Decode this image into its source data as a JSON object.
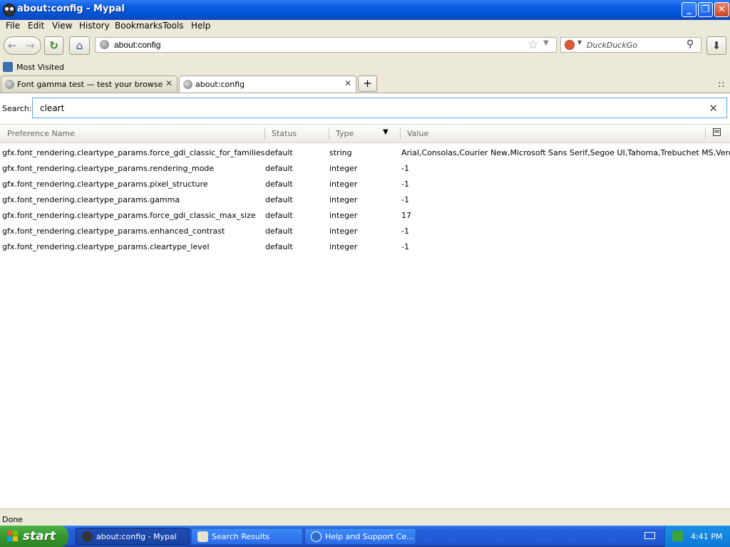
{
  "window": {
    "title": "about:config - Mypal",
    "minimize_label": "_",
    "maximize_label": "❐",
    "close_label": "✕"
  },
  "menu": [
    "File",
    "Edit",
    "View",
    "History",
    "Bookmarks",
    "Tools",
    "Help"
  ],
  "navbar": {
    "back_icon": "back-arrow-icon",
    "forward_icon": "forward-arrow-icon",
    "reload_icon": "reload-icon",
    "home_icon": "home-icon",
    "url": "about:config",
    "search_engine": "DuckDuckGo",
    "search_placeholder": "DuckDuckGo",
    "download_icon": "download-arrow-icon"
  },
  "bookmarks": {
    "most_visited": "Most Visited"
  },
  "tabs": [
    {
      "label": "Font gamma test — test your browser re...",
      "active": false
    },
    {
      "label": "about:config",
      "active": true
    }
  ],
  "config": {
    "search_label": "Search:",
    "search_value": "cleart",
    "columns": {
      "name": "Preference Name",
      "status": "Status",
      "type": "Type",
      "value": "Value"
    },
    "rows": [
      {
        "name": "gfx.font_rendering.cleartype_params.force_gdi_classic_for_families",
        "status": "default",
        "type": "string",
        "value": "Arial,Consolas,Courier New,Microsoft Sans Serif,Segoe UI,Tahoma,Trebuchet MS,Verdana"
      },
      {
        "name": "gfx.font_rendering.cleartype_params.rendering_mode",
        "status": "default",
        "type": "integer",
        "value": "-1"
      },
      {
        "name": "gfx.font_rendering.cleartype_params.pixel_structure",
        "status": "default",
        "type": "integer",
        "value": "-1"
      },
      {
        "name": "gfx.font_rendering.cleartype_params.gamma",
        "status": "default",
        "type": "integer",
        "value": "-1"
      },
      {
        "name": "gfx.font_rendering.cleartype_params.force_gdi_classic_max_size",
        "status": "default",
        "type": "integer",
        "value": "17"
      },
      {
        "name": "gfx.font_rendering.cleartype_params.enhanced_contrast",
        "status": "default",
        "type": "integer",
        "value": "-1"
      },
      {
        "name": "gfx.font_rendering.cleartype_params.cleartype_level",
        "status": "default",
        "type": "integer",
        "value": "-1"
      }
    ]
  },
  "status_bar": "Done",
  "taskbar": {
    "start": "start",
    "tasks": [
      {
        "label": "about:config - Mypal",
        "active": true
      },
      {
        "label": "Search Results",
        "active": false
      },
      {
        "label": "Help and Support Ce...",
        "active": false
      }
    ],
    "clock": "4:41 PM"
  },
  "colors": {
    "titlebar": "#0353D6",
    "start_button": "#36962E",
    "taskbar": "#245EDB",
    "focus_border": "#5BA5E6"
  }
}
